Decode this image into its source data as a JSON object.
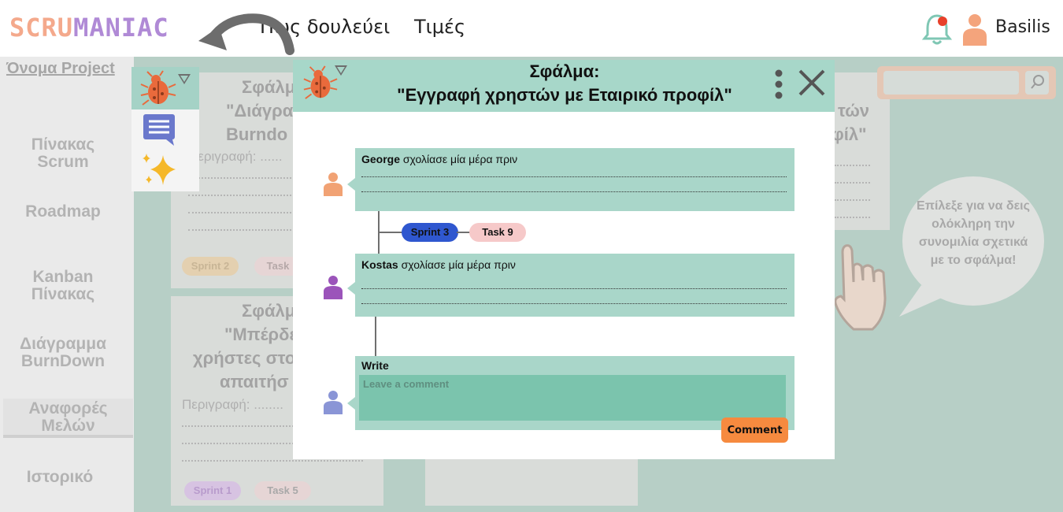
{
  "header": {
    "logo_part1": "SCRU",
    "logo_part2": "MANIAC",
    "nav_how": "Πως δουλεύει",
    "nav_pricing": "Τιμές",
    "user_name": "Basilis"
  },
  "sidebar": {
    "project_name": "Όνομα Project",
    "items": [
      {
        "line1": "Πίνακας",
        "line2": "Scrum"
      },
      {
        "line1": "Roadmap",
        "line2": ""
      },
      {
        "line1": "Kanban",
        "line2": "Πίνακας"
      },
      {
        "line1": "Διάγραμμα",
        "line2": "BurnDown"
      },
      {
        "line1": "Αναφορές",
        "line2": "Μελών"
      },
      {
        "line1": "Ιστορικό",
        "line2": ""
      }
    ]
  },
  "background": {
    "card1": {
      "title1": "Σφάλμ",
      "title2": "\"Διάγρα",
      "title3": "Burndo",
      "desc": "Περιγραφή: ......",
      "sprint": "Sprint 2",
      "task": "Task"
    },
    "card2": {
      "title1": "Σφάλμ",
      "title2": "\"Μπέρδε",
      "title3": "χρήστες στο",
      "title4": "απαιτήσ",
      "desc": "Περιγραφή: ........",
      "sprint": "Sprint 1",
      "task": "Task 5"
    },
    "card3": {
      "title1": "τών",
      "title2": "φίλ\""
    },
    "hint_bubble": "Επίλεξε για να δεις ολόκληρη την συνομιλία σχετικά με το σφάλμα!"
  },
  "modal": {
    "title_line1": "Σφάλμα:",
    "title_line2": "\"Εγγραφή χρηστών με Εταιρικό προφίλ\"",
    "comments": [
      {
        "author": "George",
        "text": "σχολίασε μία μέρα πριν"
      },
      {
        "author": "Kostas",
        "text": "σχολίασε μία μέρα πριν"
      }
    ],
    "tags": {
      "sprint": "Sprint 3",
      "task": "Task 9"
    },
    "write_label": "Write",
    "write_placeholder": "Leave a comment",
    "comment_button": "Comment"
  },
  "colors": {
    "accent_green": "#a7d7c9",
    "comment_button": "#f68a3f",
    "sprint_tag": "#2f57cf",
    "task_tag": "#f6c9c9"
  },
  "icons": [
    "back-arrow-icon",
    "bell-icon",
    "user-icon",
    "bug-icon",
    "chevron-down-icon",
    "chat-icon",
    "sparkle-icon",
    "kebab-menu-icon",
    "close-icon",
    "search-icon",
    "hand-pointer-icon"
  ]
}
